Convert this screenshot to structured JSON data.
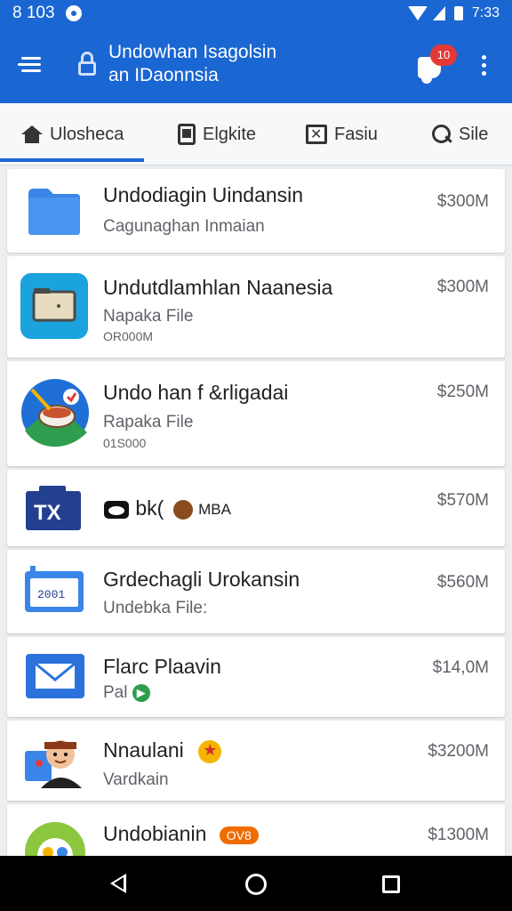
{
  "status_bar": {
    "time": "8 103",
    "clock": "7:33"
  },
  "header": {
    "title": "Undowhan Isagolsin\nan IDaonnsia",
    "notification_count": "10"
  },
  "tabs": [
    {
      "label": "Ulosheca",
      "icon": "home-icon",
      "selected": true
    },
    {
      "label": "Elgkite",
      "icon": "document-icon"
    },
    {
      "label": "Fasiu",
      "icon": "image-icon"
    },
    {
      "label": "Sile",
      "icon": "search-icon"
    }
  ],
  "files": [
    {
      "title": "Undodiagin Uindansin",
      "subtitle": "Cagunaghan Inmaian",
      "meta": "",
      "size": "$300M",
      "icon": "folder-icon"
    },
    {
      "title": "Undutdlamhlan Naanesia",
      "subtitle": "Napaka File",
      "meta": "OR000M",
      "size": "$300M",
      "icon": "file-manager-icon"
    },
    {
      "title": "Undo han f &rligadai",
      "subtitle": "Rapaka File",
      "meta": "01S000",
      "size": "$250M",
      "icon": "food-app-icon"
    },
    {
      "title": "bk(",
      "subtitle": "",
      "meta": "",
      "size": "$570M",
      "icon": "tx-icon",
      "tag": "MBA"
    },
    {
      "title": "Grdechagli Urokansin",
      "subtitle": "Undebka File:",
      "meta": "",
      "size": "$560M",
      "icon": "calendar-icon",
      "icon_text": "2001"
    },
    {
      "title": "Flarc Plaavin",
      "subtitle": "Pal",
      "meta": "",
      "size": "$14,0M",
      "icon": "mail-icon"
    },
    {
      "title": "Nnaulani",
      "subtitle": "Vardkain",
      "meta": "",
      "size": "$3200M",
      "icon": "avatar-icon"
    },
    {
      "title": "Undobianin",
      "subtitle": "",
      "meta": "",
      "size": "$1300M",
      "icon": "app-icon",
      "tag": "OV8"
    }
  ],
  "colors": {
    "primary": "#1a66d2",
    "badge": "#e53935",
    "folder": "#3a86e8"
  }
}
